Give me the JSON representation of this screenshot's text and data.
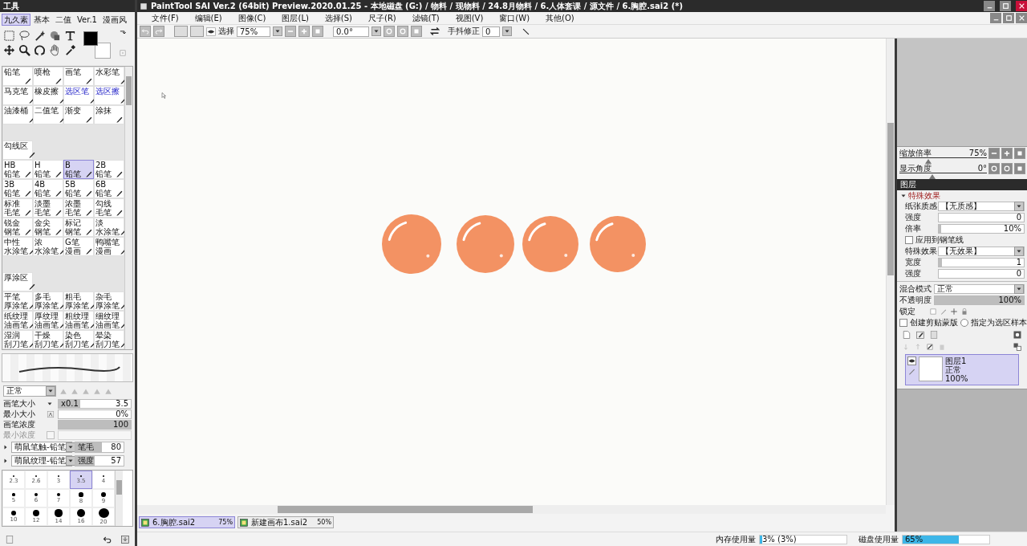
{
  "tool_panel": {
    "title": "工具",
    "tabs": [
      {
        "label": "九久素",
        "selected": true
      },
      {
        "label": "基本",
        "selected": false
      },
      {
        "label": "二值",
        "selected": false
      },
      {
        "label": "Ver.1",
        "selected": false
      },
      {
        "label": "漫画风",
        "selected": false
      }
    ],
    "brush_sections": [
      {
        "cells": [
          {
            "lines": [
              "铅笔"
            ],
            "kind": "tool",
            "selected": false
          },
          {
            "lines": [
              "喷枪"
            ],
            "kind": "tool",
            "selected": false
          },
          {
            "lines": [
              "画笔"
            ],
            "kind": "tool",
            "selected": false
          },
          {
            "lines": [
              "水彩笔"
            ],
            "kind": "tool",
            "selected": false
          },
          {
            "lines": [
              "马克笔"
            ],
            "kind": "tool",
            "selected": false
          },
          {
            "lines": [
              "橡皮擦"
            ],
            "kind": "tool",
            "selected": false
          },
          {
            "lines": [
              "选区笔"
            ],
            "kind": "selection",
            "selected": false
          },
          {
            "lines": [
              "选区擦"
            ],
            "kind": "selection",
            "selected": false
          },
          {
            "lines": [
              "油漆桶"
            ],
            "kind": "tool",
            "selected": false
          },
          {
            "lines": [
              "二值笔"
            ],
            "kind": "tool",
            "selected": false
          },
          {
            "lines": [
              "渐变"
            ],
            "kind": "tool",
            "selected": false
          },
          {
            "lines": [
              "涂抹"
            ],
            "kind": "tool",
            "selected": false
          }
        ]
      },
      {
        "header": "勾线区",
        "cells": [
          {
            "lines": [
              "HB",
              "铅笔"
            ],
            "kind": "tool",
            "selected": false
          },
          {
            "lines": [
              "H",
              "铅笔"
            ],
            "kind": "tool",
            "selected": false
          },
          {
            "lines": [
              "B",
              "铅笔"
            ],
            "kind": "tool",
            "selected": true
          },
          {
            "lines": [
              "2B",
              "铅笔"
            ],
            "kind": "tool",
            "selected": false
          },
          {
            "lines": [
              "3B",
              "铅笔"
            ],
            "kind": "tool",
            "selected": false
          },
          {
            "lines": [
              "4B",
              "铅笔"
            ],
            "kind": "tool",
            "selected": false
          },
          {
            "lines": [
              "5B",
              "铅笔"
            ],
            "kind": "tool",
            "selected": false
          },
          {
            "lines": [
              "6B",
              "铅笔"
            ],
            "kind": "tool",
            "selected": false
          },
          {
            "lines": [
              "标准",
              "毛笔"
            ],
            "kind": "tool",
            "selected": false
          },
          {
            "lines": [
              "淡墨",
              "毛笔"
            ],
            "kind": "tool",
            "selected": false
          },
          {
            "lines": [
              "浓墨",
              "毛笔"
            ],
            "kind": "tool",
            "selected": false
          },
          {
            "lines": [
              "勾线",
              "毛笔"
            ],
            "kind": "tool",
            "selected": false
          },
          {
            "lines": [
              "锐金",
              "钢笔"
            ],
            "kind": "tool",
            "selected": false
          },
          {
            "lines": [
              "金尖",
              "钢笔"
            ],
            "kind": "tool",
            "selected": false
          },
          {
            "lines": [
              "标记",
              "钢笔"
            ],
            "kind": "tool",
            "selected": false
          },
          {
            "lines": [
              "淡",
              "水涂笔"
            ],
            "kind": "tool",
            "selected": false
          },
          {
            "lines": [
              "中性",
              "水涂笔"
            ],
            "kind": "tool",
            "selected": false
          },
          {
            "lines": [
              "浓",
              "水涂笔"
            ],
            "kind": "tool",
            "selected": false
          },
          {
            "lines": [
              "G笔",
              "漫画"
            ],
            "kind": "tool",
            "selected": false
          },
          {
            "lines": [
              "鸭嘴笔",
              "漫画"
            ],
            "kind": "tool",
            "selected": false
          }
        ]
      },
      {
        "header": "厚涂区",
        "cells": [
          {
            "lines": [
              "平笔",
              "厚涂笔"
            ],
            "kind": "tool",
            "selected": false
          },
          {
            "lines": [
              "多毛",
              "厚涂笔"
            ],
            "kind": "tool",
            "selected": false
          },
          {
            "lines": [
              "粗毛",
              "厚涂笔"
            ],
            "kind": "tool",
            "selected": false
          },
          {
            "lines": [
              "杂毛",
              "厚涂笔"
            ],
            "kind": "tool",
            "selected": false
          },
          {
            "lines": [
              "纸纹理",
              "油画笔"
            ],
            "kind": "tool",
            "selected": false
          },
          {
            "lines": [
              "厚纹理",
              "油画笔"
            ],
            "kind": "tool",
            "selected": false
          },
          {
            "lines": [
              "粗纹理",
              "油画笔"
            ],
            "kind": "tool",
            "selected": false
          },
          {
            "lines": [
              "细纹理",
              "油画笔"
            ],
            "kind": "tool",
            "selected": false
          },
          {
            "lines": [
              "湿润",
              "刮刀笔"
            ],
            "kind": "tool",
            "selected": false
          },
          {
            "lines": [
              "干燥",
              "刮刀笔"
            ],
            "kind": "tool",
            "selected": false
          },
          {
            "lines": [
              "染色",
              "刮刀笔"
            ],
            "kind": "tool",
            "selected": false
          },
          {
            "lines": [
              "晕染",
              "刮刀笔"
            ],
            "kind": "tool",
            "selected": false
          }
        ]
      }
    ],
    "blend_mode": "正常",
    "params": [
      {
        "label": "画笔大小",
        "kind": "size",
        "multiplier": "x0.1",
        "value": "3.5",
        "level": 0.3,
        "disabled": false
      },
      {
        "label": "最小大小",
        "kind": "pressure",
        "value": "0%",
        "level": 0,
        "disabled": false
      },
      {
        "label": "画笔浓度",
        "kind": "plain",
        "value": "100",
        "level": 1,
        "disabled": false
      },
      {
        "label": "最小浓度",
        "kind": "checkbox",
        "level": 0,
        "disabled": true
      }
    ],
    "textures": [
      {
        "name": "萌鼠笔触-铅笔",
        "param": "笔毛",
        "value": "80",
        "level": 0.55
      },
      {
        "name": "萌鼠纹理-铅笔",
        "param": "强度",
        "value": "57",
        "level": 0.4
      }
    ],
    "sizes": [
      {
        "label": "2.3",
        "selected": false
      },
      {
        "label": "2.6",
        "selected": false
      },
      {
        "label": "3",
        "selected": false
      },
      {
        "label": "3.5",
        "selected": true
      },
      {
        "label": "4",
        "selected": false
      },
      {
        "label": "5",
        "selected": false
      },
      {
        "label": "6",
        "selected": false
      },
      {
        "label": "7",
        "selected": false
      },
      {
        "label": "8",
        "selected": false
      },
      {
        "label": "9",
        "selected": false
      },
      {
        "label": "10",
        "selected": false
      },
      {
        "label": "12",
        "selected": false
      },
      {
        "label": "14",
        "selected": false
      },
      {
        "label": "16",
        "selected": false
      },
      {
        "label": "20",
        "selected": false
      }
    ]
  },
  "main_window": {
    "title": "PaintTool SAI Ver.2 (64bit) Preview.2020.01.25 - 本地磁盘 (G:) / 物料 / 现物料 / 24.8月物料 / 6.人体套课 / 源文件 / 6.胸腔.sai2 (*)",
    "menu": [
      "文件(F)",
      "编辑(E)",
      "图像(C)",
      "图层(L)",
      "选择(S)",
      "尺子(R)",
      "滤镜(T)",
      "视图(V)",
      "窗口(W)",
      "其他(O)"
    ],
    "toolbar": {
      "select_label": "选择",
      "zoom": "75%",
      "angle": "0.0°",
      "stabilizer_label": "手抖修正",
      "stabilizer": "0"
    },
    "doc_tabs": [
      {
        "name": "6.胸腔.sai2",
        "zoom": "75%",
        "selected": true
      },
      {
        "name": "新建画布1.sai2",
        "zoom": "50%",
        "selected": false
      }
    ],
    "status": [
      {
        "label": "内存使用量",
        "value": "3% (3%)",
        "level": 0.03
      },
      {
        "label": "磁盘使用量",
        "value": "65%",
        "level": 0.65
      }
    ]
  },
  "layer_panel": {
    "sliders": [
      {
        "label": "缩放倍率",
        "value": "75%",
        "level": 0.33,
        "kind": "zoom"
      },
      {
        "label": "显示角度",
        "value": "0°",
        "level": 0.38,
        "kind": "angle"
      }
    ],
    "title": "图层",
    "effects": {
      "label": "特殊效果",
      "expanded": true
    },
    "rows": [
      {
        "kind": "select",
        "label": "纸张质感",
        "value": "【无质感】"
      },
      {
        "kind": "field",
        "label": "强度",
        "value": "0",
        "level": 0
      },
      {
        "kind": "field",
        "label": "倍率",
        "value": "10%",
        "level": 0.02
      },
      {
        "kind": "checkbox",
        "label": "应用到钢笔线",
        "checked": false
      },
      {
        "kind": "select",
        "label": "特殊效果",
        "value": "【无效果】"
      },
      {
        "kind": "field",
        "label": "宽度",
        "value": "1",
        "level": 0.04
      },
      {
        "kind": "field",
        "label": "强度",
        "value": "0",
        "level": 0
      }
    ],
    "blend": {
      "label": "混合模式",
      "value": "正常"
    },
    "opacity": {
      "label": "不透明度",
      "value": "100%",
      "level": 1
    },
    "lock_label": "锁定",
    "clip": {
      "label": "创建剪贴蒙版",
      "checked": false
    },
    "sample": {
      "label": "指定为选区样本",
      "selected": false
    },
    "layers": [
      {
        "name": "图层1",
        "mode": "正常",
        "opacity": "100%",
        "selected": true,
        "visible": true
      }
    ]
  }
}
